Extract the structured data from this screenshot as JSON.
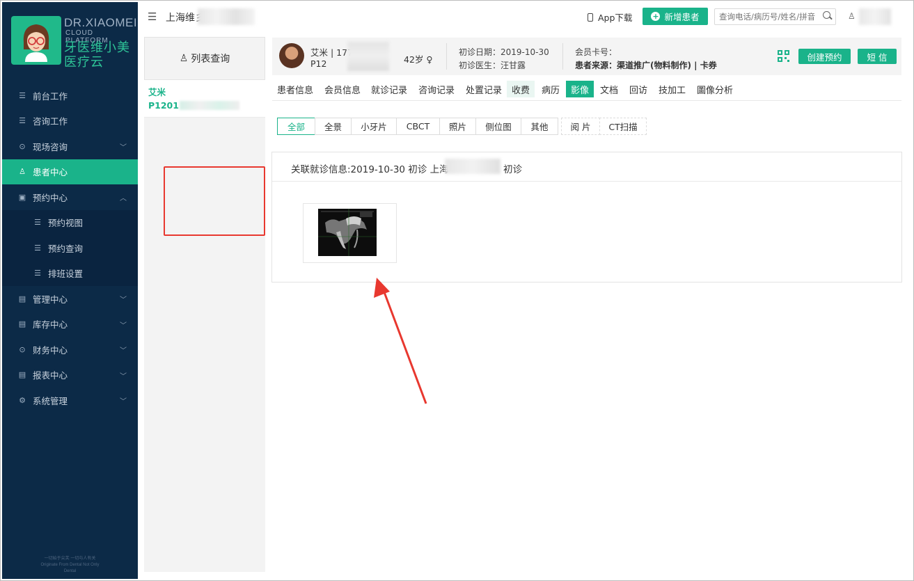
{
  "brand": {
    "en_line1": "DR.XIAOMEI",
    "en_line2": "CLOUD PLATFORM",
    "cn_line1": "牙医维小美",
    "cn_line2": "医疗云",
    "accent": "#1ab38a",
    "sidebar_bg": "#0c2a47"
  },
  "sidebar": {
    "items": [
      {
        "label": "前台工作",
        "icon": "list-icon"
      },
      {
        "label": "咨询工作",
        "icon": "list-icon"
      },
      {
        "label": "现场咨询",
        "icon": "coin-icon",
        "chevron": "down"
      },
      {
        "label": "患者中心",
        "icon": "user-icon",
        "active": true
      },
      {
        "label": "预约中心",
        "icon": "calendar-icon",
        "chevron": "up"
      },
      {
        "label": "预约视图",
        "icon": "bullet-list-icon",
        "sub": true
      },
      {
        "label": "预约查询",
        "icon": "bullet-list-icon",
        "sub": true
      },
      {
        "label": "排班设置",
        "icon": "bullet-list-icon",
        "sub": true
      },
      {
        "label": "管理中心",
        "icon": "briefcase-icon",
        "chevron": "down"
      },
      {
        "label": "库存中心",
        "icon": "briefcase-icon",
        "chevron": "down"
      },
      {
        "label": "财务中心",
        "icon": "coin-icon",
        "chevron": "down"
      },
      {
        "label": "报表中心",
        "icon": "briefcase-icon",
        "chevron": "down"
      },
      {
        "label": "系统管理",
        "icon": "gear-icon",
        "chevron": "down"
      }
    ],
    "footer_line1": "一切始于尖芙 一切与人有关",
    "footer_line2": "Originate From Dental Not Only",
    "footer_line3": "Dental"
  },
  "topbar": {
    "clinic": "上海维彡",
    "app_download": "App下载",
    "new_patient": "新增患者",
    "search_placeholder": "查询电话/病历号/姓名/拼音"
  },
  "left_list": {
    "query_button": "列表查询",
    "entry_name": "艾米",
    "entry_id": "P1201"
  },
  "patient": {
    "name_phone": "艾米 | 177",
    "id": "P12",
    "age": "42岁 ♀",
    "first_visit_date": "初诊日期：2019-10-30",
    "first_visit_doctor": "初诊医生：汪甘露",
    "member_card": "会员卡号：",
    "source": "患者来源：渠道推广(物料制作) | 卡券",
    "btn_create_appointment": "创建预约",
    "btn_sms": "短 信"
  },
  "tabs": [
    "患者信息",
    "会员信息",
    "就诊记录",
    "咨询记录",
    "处置记录",
    "收费",
    "病历",
    "影像",
    "文档",
    "回访",
    "技加工",
    "圖像分析"
  ],
  "filters": [
    "全部",
    "全景",
    "小牙片",
    "CBCT",
    "照片",
    "侧位图",
    "其他",
    "阅 片",
    "CT扫描"
  ],
  "image_panel": {
    "visit_info": "关联就诊信息:2019-10-30 初诊 上海",
    "visit_info_tail": "初诊"
  }
}
